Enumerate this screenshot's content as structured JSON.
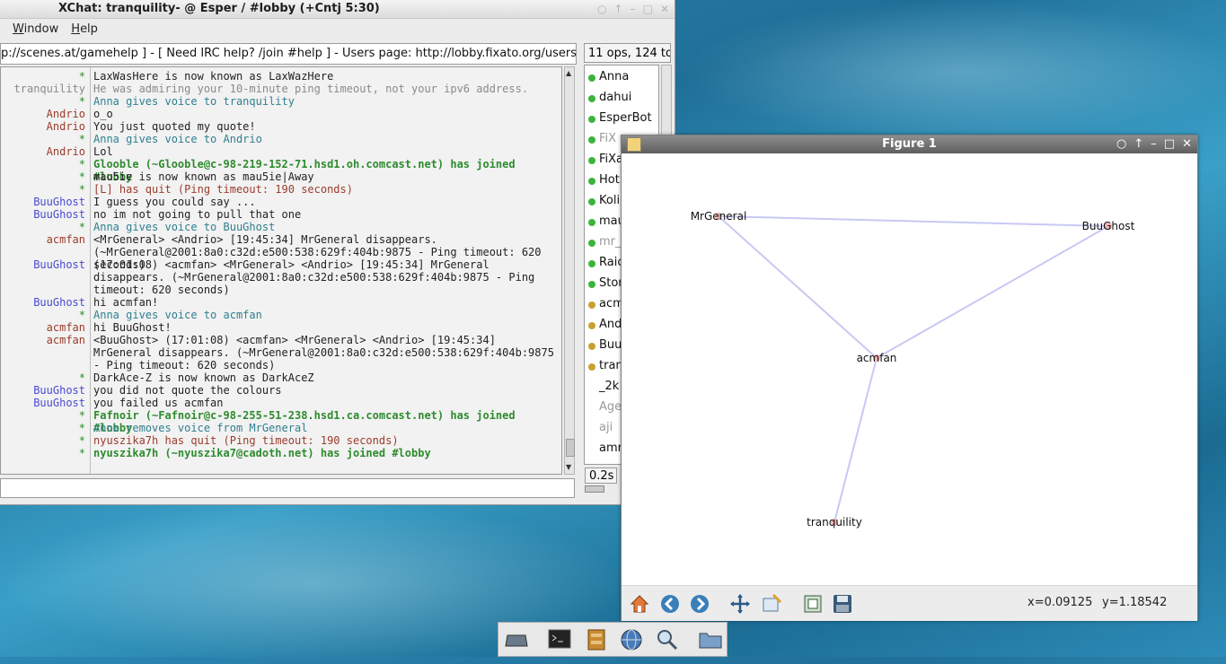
{
  "xchat": {
    "title": "XChat: tranquility- @ Esper / #lobby (+Cntj 5:30)",
    "menu": [
      "Window",
      "Help"
    ],
    "topic": "p://scenes.at/gamehelp ] - [ Need IRC help? /join #help ] - Users page: http://lobby.fixato.org/users",
    "user_count": "11 ops, 124 total",
    "lag": "0.2s",
    "lines": [
      {
        "nick": "*",
        "nick_color": "green",
        "text": "LaxWasHere is now known as LaxWazHere",
        "text_color": "dark"
      },
      {
        "nick": "tranquility",
        "nick_color": "gray",
        "text": "He was admiring your 10-minute ping timeout, not your ipv6 address.",
        "text_color": "gray"
      },
      {
        "nick": "*",
        "nick_color": "green",
        "text": "Anna gives voice to tranquility",
        "text_color": "teal"
      },
      {
        "nick": "Andrio",
        "nick_color": "red",
        "text": "o_o",
        "text_color": "dark"
      },
      {
        "nick": "Andrio",
        "nick_color": "red",
        "text": "You just quoted my quote!",
        "text_color": "dark"
      },
      {
        "nick": "*",
        "nick_color": "green",
        "text": "Anna gives voice to Andrio",
        "text_color": "teal"
      },
      {
        "nick": "Andrio",
        "nick_color": "red",
        "text": "Lol",
        "text_color": "dark"
      },
      {
        "nick": "*",
        "nick_color": "green",
        "text": "Glooble (~Glooble@c-98-219-152-71.hsd1.oh.comcast.net) has joined #lobby",
        "text_color": "green"
      },
      {
        "nick": "*",
        "nick_color": "green",
        "text": "mau5ie is now known as mau5ie|Away",
        "text_color": "dark"
      },
      {
        "nick": "*",
        "nick_color": "green",
        "text": "[L] has quit (Ping timeout: 190 seconds)",
        "text_color": "red"
      },
      {
        "nick": "BuuGhost",
        "nick_color": "blue",
        "text": "I guess you could say ...",
        "text_color": "dark"
      },
      {
        "nick": "BuuGhost",
        "nick_color": "blue",
        "text": "no im not going to pull that one",
        "text_color": "dark"
      },
      {
        "nick": "*",
        "nick_color": "green",
        "text": "Anna gives voice to BuuGhost",
        "text_color": "teal"
      },
      {
        "nick": "acmfan",
        "nick_color": "red",
        "text": "<MrGeneral> <Andrio> [19:45:34] MrGeneral disappears. (~MrGeneral@2001:8a0:c32d:e500:538:629f:404b:9875 - Ping timeout: 620 seconds)",
        "text_color": "dark"
      },
      {
        "nick": "BuuGhost",
        "nick_color": "blue",
        "text": "(17:01:08) <acmfan> <MrGeneral> <Andrio> [19:45:34] MrGeneral disappears. (~MrGeneral@2001:8a0:c32d:e500:538:629f:404b:9875 - Ping timeout: 620 seconds)",
        "text_color": "dark"
      },
      {
        "nick": "BuuGhost",
        "nick_color": "blue",
        "text": "hi acmfan!",
        "text_color": "dark"
      },
      {
        "nick": "*",
        "nick_color": "green",
        "text": "Anna gives voice to acmfan",
        "text_color": "teal"
      },
      {
        "nick": "acmfan",
        "nick_color": "red",
        "text": "hi BuuGhost!",
        "text_color": "dark"
      },
      {
        "nick": "acmfan",
        "nick_color": "red",
        "text": "<BuuGhost> (17:01:08) <acmfan> <MrGeneral> <Andrio> [19:45:34] MrGeneral disappears. (~MrGeneral@2001:8a0:c32d:e500:538:629f:404b:9875 - Ping timeout: 620 seconds)",
        "text_color": "dark"
      },
      {
        "nick": "*",
        "nick_color": "green",
        "text": "DarkAce-Z is now known as DarkAceZ",
        "text_color": "dark"
      },
      {
        "nick": "BuuGhost",
        "nick_color": "blue",
        "text": "you did not quote the colours",
        "text_color": "dark"
      },
      {
        "nick": "BuuGhost",
        "nick_color": "blue",
        "text": "you failed us acmfan",
        "text_color": "dark"
      },
      {
        "nick": "*",
        "nick_color": "green",
        "text": "Fafnoir (~Fafnoir@c-98-255-51-238.hsd1.ca.comcast.net) has joined #lobby",
        "text_color": "green"
      },
      {
        "nick": "*",
        "nick_color": "green",
        "text": "Anna removes voice from MrGeneral",
        "text_color": "teal"
      },
      {
        "nick": "*",
        "nick_color": "green",
        "text": "nyuszika7h has quit (Ping timeout: 190 seconds)",
        "text_color": "red"
      },
      {
        "nick": "*",
        "nick_color": "green",
        "text": "nyuszika7h (~nyuszika7@cadoth.net) has joined #lobby",
        "text_color": "green"
      }
    ],
    "users": [
      {
        "name": "Anna",
        "status": "op"
      },
      {
        "name": "dahui",
        "status": "op"
      },
      {
        "name": "EsperBot",
        "status": "op"
      },
      {
        "name": "FiX",
        "status": "op-away"
      },
      {
        "name": "FiXa",
        "status": "op"
      },
      {
        "name": "Hot",
        "status": "op"
      },
      {
        "name": "Koli",
        "status": "op"
      },
      {
        "name": "mau",
        "status": "op"
      },
      {
        "name": "mr_",
        "status": "op-away"
      },
      {
        "name": "Raic",
        "status": "op"
      },
      {
        "name": "Stor",
        "status": "op"
      },
      {
        "name": "acm",
        "status": "voice"
      },
      {
        "name": "And",
        "status": "voice"
      },
      {
        "name": "Buu",
        "status": "voice"
      },
      {
        "name": "tran",
        "status": "voice"
      },
      {
        "name": "_2k",
        "status": "none"
      },
      {
        "name": "Age",
        "status": "none-away"
      },
      {
        "name": "aji",
        "status": "none-away"
      },
      {
        "name": "amr",
        "status": "none"
      }
    ]
  },
  "figure": {
    "title": "Figure 1",
    "coords": {
      "x": "x=0.09125",
      "y": "y=1.18542"
    },
    "graph": {
      "nodes": [
        "MrGeneral",
        "BuuGhost",
        "acmfan",
        "tranquility"
      ],
      "edges": [
        [
          "MrGeneral",
          "BuuGhost"
        ],
        [
          "MrGeneral",
          "acmfan"
        ],
        [
          "BuuGhost",
          "acmfan"
        ],
        [
          "acmfan",
          "tranquility"
        ]
      ]
    },
    "toolbar": [
      "home-icon",
      "back-icon",
      "forward-icon",
      "pan-icon",
      "zoom-icon",
      "subplots-icon",
      "save-icon"
    ]
  },
  "taskbar": [
    "show-desktop-icon",
    "terminal-icon",
    "file-manager-icon",
    "web-browser-icon",
    "search-icon",
    "folder-icon"
  ],
  "colors": {
    "node": "#f4b4b4",
    "edge": "#c8c8f4",
    "op_dot": "#3cb43c",
    "voice_dot": "#c8a030"
  }
}
